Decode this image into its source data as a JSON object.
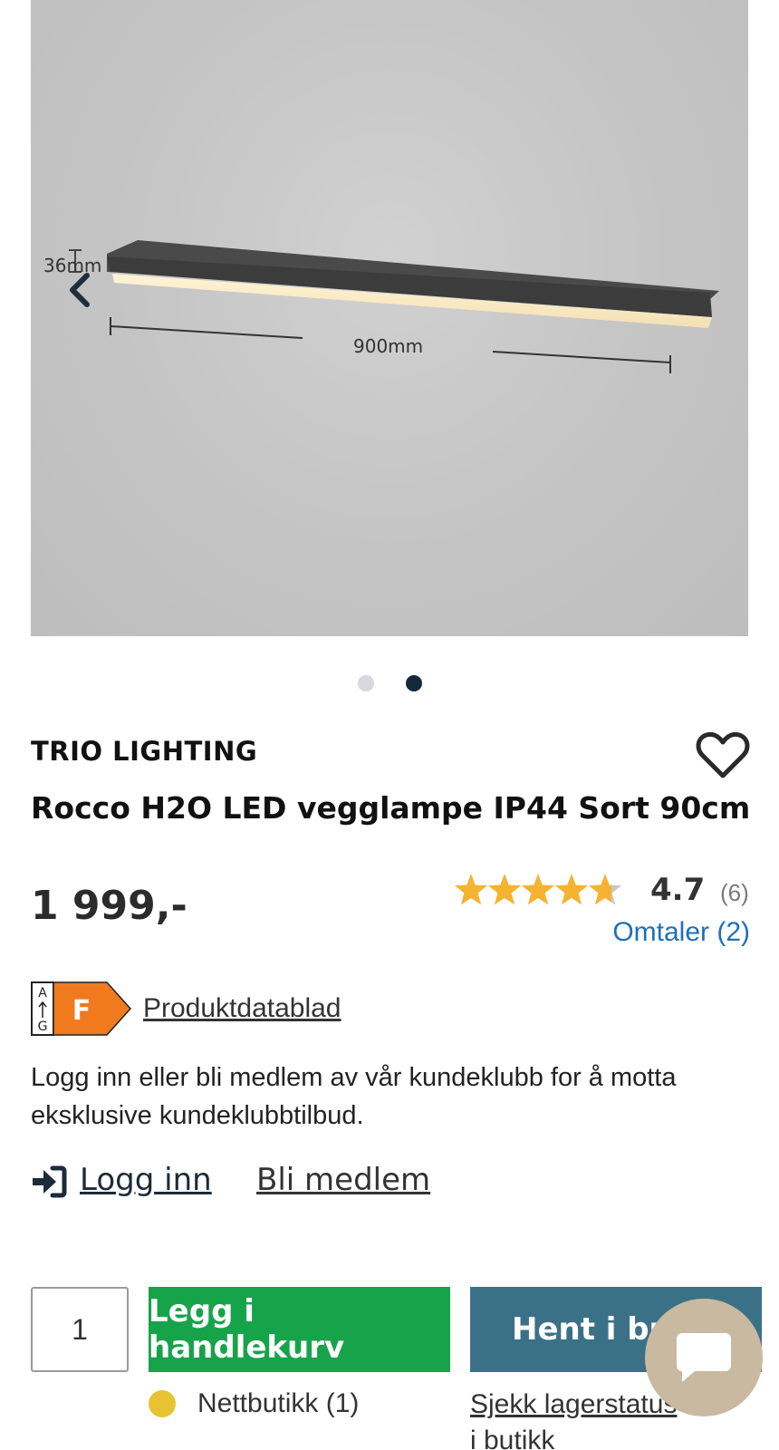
{
  "gallery": {
    "dimension_height": "36mm",
    "dimension_width": "900mm",
    "prev_icon": "chevron-left-icon",
    "slides_count": 2,
    "active_slide": 2
  },
  "product": {
    "brand": "TRIO LIGHTING",
    "title": "Rocco H2O LED vegglampe IP44 Sort 90cm",
    "price": "1 999,-",
    "favorite_icon": "heart-outline-icon"
  },
  "rating": {
    "value": "4.7",
    "count": "(6)",
    "stars": 4.7,
    "star_color": "#f5b331",
    "reviews_link": "Omtaler (2)"
  },
  "energy": {
    "scale_top": "A",
    "scale_bottom": "G",
    "class": "F",
    "class_color": "#f07a1d",
    "datasheet_link": "Produktdatablad"
  },
  "membership": {
    "info_text": "Logg inn eller bli medlem av vår kundeklubb for å motta eksklusive kundeklubbtilbud.",
    "login_label": "Logg inn",
    "join_label": "Bli medlem"
  },
  "purchase": {
    "quantity": "1",
    "add_to_cart_label": "Legg i handlekurv",
    "pickup_label": "Hent i butikk",
    "online_stock": "Nettbutikk (1)",
    "online_stock_color": "#e8c331",
    "check_stock_link": "Sjekk lagerstatus i butikk"
  },
  "colors": {
    "cart_button": "#17a34a",
    "store_button": "#3b7186",
    "link_blue": "#1f6fb8",
    "chat_bubble": "#c9b9a0"
  }
}
